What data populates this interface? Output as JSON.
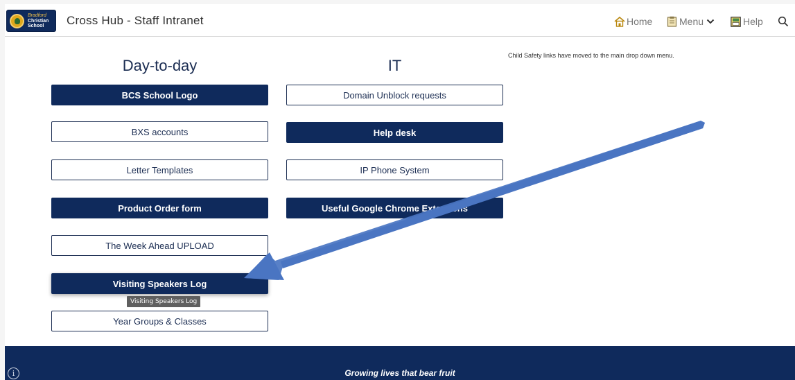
{
  "header": {
    "site_title": "Cross Hub - Staff Intranet",
    "logo": {
      "line1": "Bradford",
      "line2": "Christian",
      "line3": "School"
    },
    "nav": {
      "home": "Home",
      "menu": "Menu",
      "help": "Help"
    },
    "icons": [
      "home-icon",
      "clipboard-icon",
      "chevron-down-icon",
      "help-book-icon",
      "search-icon"
    ]
  },
  "columns": {
    "day_to_day": {
      "heading": "Day-to-day",
      "buttons": [
        "BCS School Logo",
        "BXS accounts",
        "Letter Templates",
        "Product Order form",
        "The Week Ahead UPLOAD",
        "Visiting Speakers Log",
        "Year Groups & Classes"
      ]
    },
    "it": {
      "heading": "IT",
      "buttons": [
        "Domain Unblock requests",
        "Help desk",
        "IP Phone System",
        "Useful Google Chrome Extentions"
      ]
    }
  },
  "tooltip": "Visiting Speakers Log",
  "notice": "Child Safety links have moved to the main drop down menu.",
  "footer": {
    "tagline": "Growing lives that bear fruit"
  },
  "colors": {
    "navy": "#0f2a5c",
    "arrow": "#4a75c2",
    "gold": "#e0a81c"
  }
}
